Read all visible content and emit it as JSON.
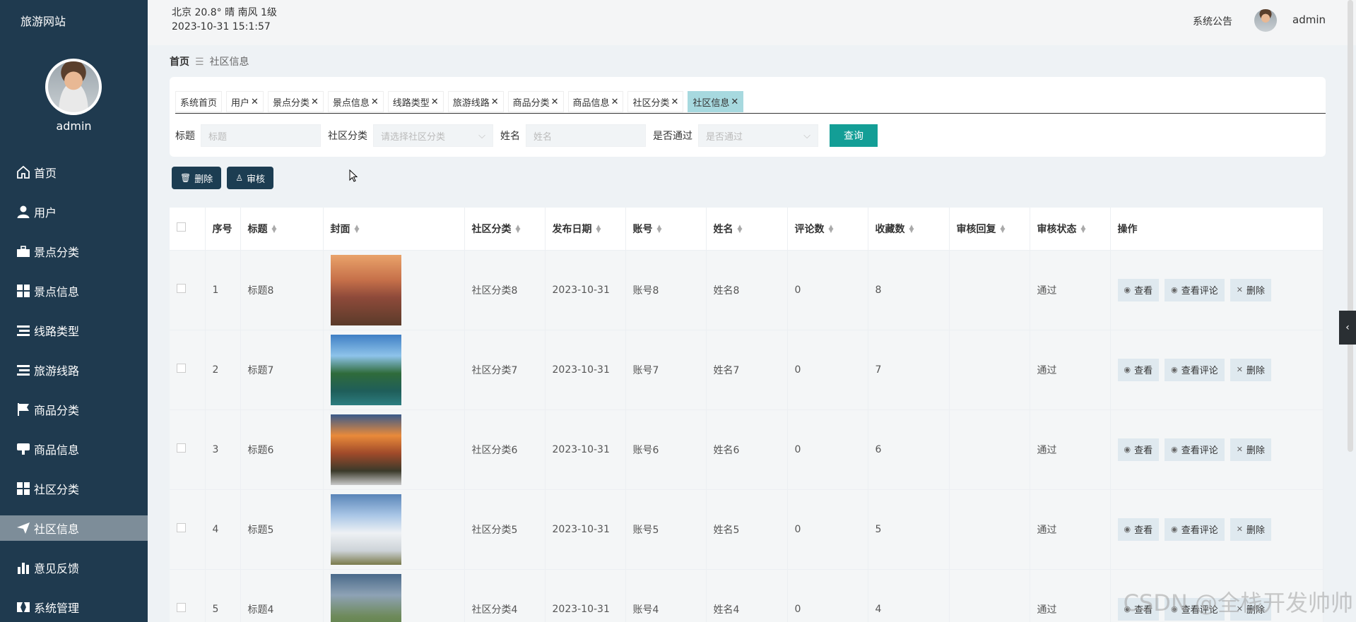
{
  "app": {
    "brand": "旅游网站",
    "user": "admin"
  },
  "topbar": {
    "weather": "北京  20.8°  晴  南风  1级",
    "datetime": "2023-10-31 15:1:57",
    "notice": "系统公告",
    "user": "admin"
  },
  "sidebar": {
    "items": [
      {
        "label": "首页",
        "icon": "home-icon"
      },
      {
        "label": "用户",
        "icon": "user-icon"
      },
      {
        "label": "景点分类",
        "icon": "briefcase-icon"
      },
      {
        "label": "景点信息",
        "icon": "grid-icon"
      },
      {
        "label": "线路类型",
        "icon": "list-icon"
      },
      {
        "label": "旅游线路",
        "icon": "list-icon"
      },
      {
        "label": "商品分类",
        "icon": "flag-icon"
      },
      {
        "label": "商品信息",
        "icon": "download-icon"
      },
      {
        "label": "社区分类",
        "icon": "grid-icon"
      },
      {
        "label": "社区信息",
        "icon": "send-icon",
        "active": true
      },
      {
        "label": "意见反馈",
        "icon": "bar-chart-icon"
      },
      {
        "label": "系统管理",
        "icon": "tools-icon"
      }
    ]
  },
  "breadcrumb": {
    "home": "首页",
    "current": "社区信息"
  },
  "tabs": [
    {
      "label": "系统首页",
      "closable": false
    },
    {
      "label": "用户",
      "closable": true
    },
    {
      "label": "景点分类",
      "closable": true
    },
    {
      "label": "景点信息",
      "closable": true
    },
    {
      "label": "线路类型",
      "closable": true
    },
    {
      "label": "旅游线路",
      "closable": true
    },
    {
      "label": "商品分类",
      "closable": true
    },
    {
      "label": "商品信息",
      "closable": true
    },
    {
      "label": "社区分类",
      "closable": true
    },
    {
      "label": "社区信息",
      "closable": true,
      "active": true
    }
  ],
  "search": {
    "title_label": "标题",
    "title_placeholder": "标题",
    "category_label": "社区分类",
    "category_placeholder": "请选择社区分类",
    "name_label": "姓名",
    "name_placeholder": "姓名",
    "approved_label": "是否通过",
    "approved_placeholder": "是否通过",
    "query_button": "查询"
  },
  "actions": {
    "delete": "删除",
    "review": "审核"
  },
  "table": {
    "headers": [
      "序号",
      "标题",
      "封面",
      "社区分类",
      "发布日期",
      "账号",
      "姓名",
      "评论数",
      "收藏数",
      "审核回复",
      "审核状态",
      "操作"
    ],
    "sortable": [
      false,
      true,
      true,
      true,
      true,
      true,
      true,
      true,
      true,
      true,
      true,
      false
    ],
    "rows": [
      {
        "no": "1",
        "title": "标题8",
        "cover": "cover-house",
        "category": "社区分类8",
        "date": "2023-10-31",
        "account": "账号8",
        "name": "姓名8",
        "comments": "0",
        "favorites": "8",
        "reply": "",
        "status": "通过"
      },
      {
        "no": "2",
        "title": "标题7",
        "cover": "cover-lake",
        "category": "社区分类7",
        "date": "2023-10-31",
        "account": "账号7",
        "name": "姓名7",
        "comments": "0",
        "favorites": "7",
        "reply": "",
        "status": "通过"
      },
      {
        "no": "3",
        "title": "标题6",
        "cover": "cover-sunset",
        "category": "社区分类6",
        "date": "2023-10-31",
        "account": "账号6",
        "name": "姓名6",
        "comments": "0",
        "favorites": "6",
        "reply": "",
        "status": "通过"
      },
      {
        "no": "4",
        "title": "标题5",
        "cover": "cover-clouds",
        "category": "社区分类5",
        "date": "2023-10-31",
        "account": "账号5",
        "name": "姓名5",
        "comments": "0",
        "favorites": "5",
        "reply": "",
        "status": "通过"
      },
      {
        "no": "5",
        "title": "标题4",
        "cover": "cover-terrace",
        "category": "社区分类4",
        "date": "2023-10-31",
        "account": "账号4",
        "name": "姓名4",
        "comments": "0",
        "favorites": "4",
        "reply": "",
        "status": "通过"
      }
    ],
    "ops": {
      "view": "查看",
      "view_comments": "查看评论",
      "delete": "删除"
    }
  },
  "watermark": "CSDN @全栈开发帅帅",
  "colors": {
    "sidebar": "#1f3a4f",
    "accent": "#139e96",
    "active_tab": "#a7d9df",
    "action_button": "#1c3d52"
  }
}
